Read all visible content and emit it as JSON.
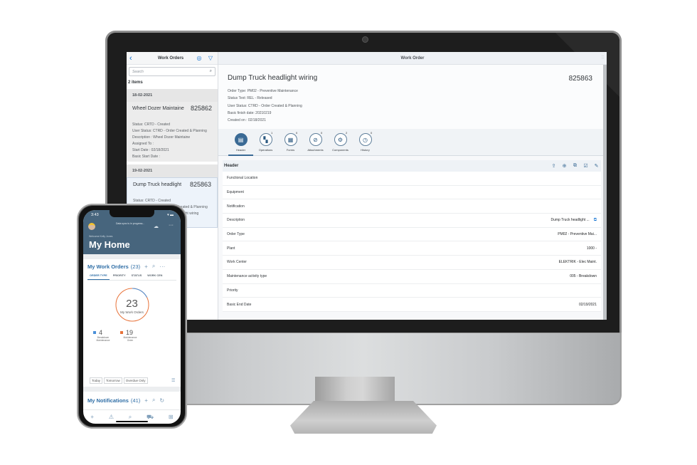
{
  "desktop": {
    "master": {
      "title": "Work Orders",
      "back_icon": "chevron-left-icon",
      "location_icon": "location-pin-icon",
      "filter_icon": "filter-icon",
      "search_placeholder": "Search",
      "items_count": "2 items",
      "groups": [
        {
          "date": "18-02-2021",
          "item": {
            "title": "Wheel Dozer Maintaine",
            "number": "825862",
            "lines": [
              "Status: CRTD - Created",
              "User Status: CTRD - Order Created & Planning",
              "Description : Wheel Dozer Maintaine",
              "Assigned To :",
              "Start Date : 02/18/2021",
              "Basic Start Date :"
            ]
          }
        },
        {
          "date": "19-02-2021",
          "item": {
            "title": "Dump Truck headlight",
            "number": "825863",
            "lines": [
              "Status: CRTD - Created",
              "User Status: CTRD - Order Created & Planning",
              "Description : Dump Truck headlight wiring"
            ]
          }
        }
      ]
    },
    "detail": {
      "bar_title": "Work Order",
      "title": "Dump Truck headlight wiring",
      "number": "825863",
      "attributes": [
        "Order Type: PM02 - Preventive Maintenance",
        "Status Text: REL - Released",
        "User Status: CTRD - Order Created & Planning",
        "Basic finish date: 20210219",
        "Created on : 02/18/2021"
      ],
      "tabs": [
        {
          "label": "Header",
          "count": "",
          "icon": "document-icon",
          "glyph": "▤"
        },
        {
          "label": "Operations",
          "count": "1",
          "icon": "operations-icon",
          "glyph": "▚"
        },
        {
          "label": "Forms",
          "count": "0",
          "icon": "form-icon",
          "glyph": "▦"
        },
        {
          "label": "Attachments",
          "count": "0",
          "icon": "paperclip-icon",
          "glyph": "⊘"
        },
        {
          "label": "Components",
          "count": "2",
          "icon": "gears-icon",
          "glyph": "⚙"
        },
        {
          "label": "History",
          "count": "0",
          "icon": "clock-icon",
          "glyph": "◷"
        }
      ],
      "section_title": "Header",
      "section_actions": [
        {
          "name": "upload-icon",
          "glyph": "⇪"
        },
        {
          "name": "add-icon",
          "glyph": "⊕"
        },
        {
          "name": "copy-icon",
          "glyph": "⧉"
        },
        {
          "name": "checkbox-icon",
          "glyph": "☑"
        },
        {
          "name": "edit-icon",
          "glyph": "✎"
        }
      ],
      "fields": [
        {
          "label": "Functional Location",
          "value": ""
        },
        {
          "label": "Equipment",
          "value": ""
        },
        {
          "label": "Notification",
          "value": ""
        },
        {
          "label": "Description",
          "value": "Dump Truck headlight ..."
        },
        {
          "label": "Order Type",
          "value": "PM02 - Preventive Mai..."
        },
        {
          "label": "Plant",
          "value": "1000 -"
        },
        {
          "label": "Work Center",
          "value": "ELEKTRIK - Elec Maint."
        },
        {
          "label": "Maintenance activity type",
          "value": "005 - Breakdown"
        },
        {
          "label": "Priority",
          "value": ""
        },
        {
          "label": "Basic End Date",
          "value": "02/19/2021"
        }
      ]
    }
  },
  "phone": {
    "time": "3:43",
    "status_icons": "▾ ▬",
    "sync_text": "Data sync is in progress...",
    "welcome": "Welcome  Kelly Jones",
    "home_title": "My Home",
    "work_orders": {
      "title": "My Work Orders",
      "count": "(23)",
      "tabs": [
        "ORDER TYPE",
        "PRIORITY",
        "STATUS",
        "WORK CEN"
      ],
      "total": "23",
      "total_label": "My Work Orders",
      "legend": [
        {
          "value": "4",
          "label": "Breakdown Maintenance",
          "color": "#4a90d9"
        },
        {
          "value": "19",
          "label": "Maintenance Order",
          "color": "#e8733a"
        }
      ],
      "filters": [
        "Today",
        "Tomorrow",
        "Overdue Only"
      ]
    },
    "notifications": {
      "title": "My Notifications",
      "count": "(41)"
    }
  },
  "colors": {
    "accent": "#2f6ea6",
    "phone_header": "#47657d",
    "breakdown": "#4a90d9",
    "maintenance": "#e8733a"
  }
}
